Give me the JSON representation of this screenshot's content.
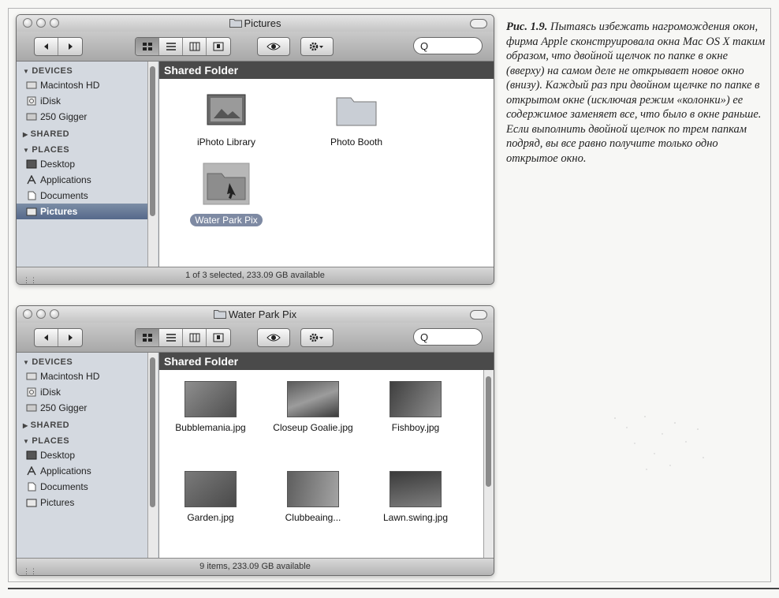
{
  "caption": {
    "fig_label": "Рис. 1.9.",
    "text": "Пытаясь избежать нагромождения окон, фирма Apple сконструировала окна Mac OS X таким образом, что двойной щелчок по папке в окне (вверху) на самом деле не открывает новое окно (внизу). Каждый раз при двойном щелчке по папке в открытом окне (исключая режим «колонки») ее содержимое заменяет все, что было в окне раньше. Если выполнить двойной щелчок по трем папкам подряд, вы все равно получите только одно открытое окно."
  },
  "sidebar": {
    "devices_header": "DEVICES",
    "devices": [
      "Macintosh HD",
      "iDisk",
      "250 Gigger"
    ],
    "shared_header": "SHARED",
    "places_header": "PLACES",
    "places": [
      "Desktop",
      "Applications",
      "Documents",
      "Pictures"
    ]
  },
  "search_glyph": "Q",
  "path_header": "Shared Folder",
  "window1": {
    "title": "Pictures",
    "items": [
      "iPhoto Library",
      "Photo Booth",
      "Water Park Pix"
    ],
    "status": "1 of 3 selected, 233.09 GB available"
  },
  "window2": {
    "title": "Water Park Pix",
    "items": [
      "Bubblemania.jpg",
      "Closeup Goalie.jpg",
      "Fishboy.jpg",
      "Garden.jpg",
      "Clubbeaing...",
      "Lawn.swing.jpg"
    ],
    "status": "9 items, 233.09 GB available"
  },
  "colors": {
    "sidebar": "#d4d9e0",
    "selection": "#55688a",
    "path_bar": "#4a4a4a"
  }
}
